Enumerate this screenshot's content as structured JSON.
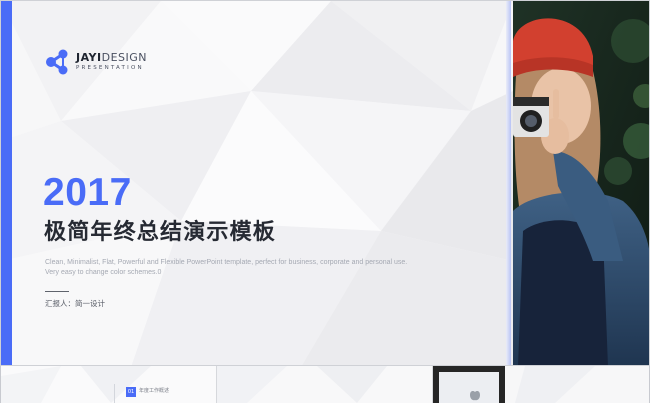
{
  "slide": {
    "logo": {
      "brand_bold": "JAYI",
      "brand_light": "DESIGN",
      "subtitle": "PRESENTATION"
    },
    "year": "2017",
    "title": "极简年终总结演示模板",
    "description": "Clean, Minimalist, Flat, Powerful and Flexible PowerPoint template, perfect for business, corporate and personal use. Very easy to change color schemes.0",
    "reporter": "汇报人：简一设计"
  },
  "thumbnails": [
    {
      "number": "01",
      "label": "年度工作概述"
    }
  ],
  "colors": {
    "accent": "#4a6cf7",
    "title": "#262a33",
    "description": "#a5a9b3"
  },
  "icons": {
    "logo": "molecule-logo-icon"
  }
}
